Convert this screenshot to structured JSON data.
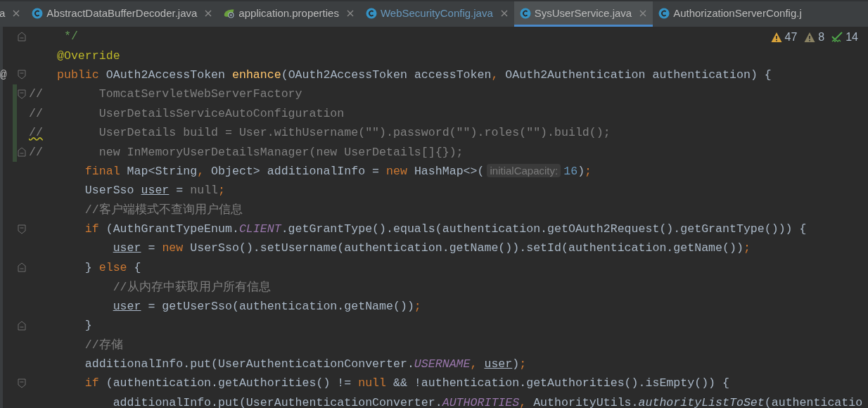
{
  "tabs": [
    {
      "label": "a",
      "kind": "plain",
      "selected": false,
      "closable": true
    },
    {
      "label": "AbstractDataBufferDecoder.java",
      "kind": "class",
      "selected": false,
      "closable": true
    },
    {
      "label": "application.properties",
      "kind": "spring",
      "selected": false,
      "closable": true
    },
    {
      "label": "WebSecurityConfig.java",
      "kind": "class",
      "selected": false,
      "closable": true
    },
    {
      "label": "SysUserService.java",
      "kind": "class",
      "selected": true,
      "closable": true
    },
    {
      "label": "AuthorizationServerConfig.j",
      "kind": "class",
      "selected": false,
      "closable": false
    }
  ],
  "inspections": [
    {
      "kind": "warning",
      "count": "47"
    },
    {
      "kind": "weak-warning",
      "count": "8"
    },
    {
      "kind": "typo",
      "count": "14"
    }
  ],
  "lines": [
    {
      "fold_end": true,
      "tokens": [
        {
          "kind": "doc",
          "text": " */"
        }
      ]
    },
    {
      "tokens": [
        {
          "kind": "ann",
          "text": "@Override"
        }
      ]
    },
    {
      "at_mark": "@",
      "fold_start": true,
      "tokens": [
        {
          "kind": "kw",
          "text": "public "
        },
        {
          "kind": "p",
          "text": "OAuth2AccessToken "
        },
        {
          "kind": "decl",
          "text": "enhance"
        },
        {
          "kind": "p",
          "text": "(OAuth2AccessToken accessToken"
        },
        {
          "kind": "kw",
          "text": ", "
        },
        {
          "kind": "p",
          "text": "OAuth2Authentication authentication) {"
        }
      ],
      "children": [
        {
          "changed": true,
          "fold_start": true,
          "prefix": "//",
          "tokens": [
            {
              "kind": "cm",
              "text": "  TomcatServletWebServerFactory"
            }
          ]
        },
        {
          "changed": true,
          "prefix": "//",
          "tokens": [
            {
              "kind": "cm",
              "text": "  UserDetailsServiceAutoConfiguration"
            }
          ]
        },
        {
          "changed": true,
          "prefix": "//",
          "squiggle": true,
          "tokens": [
            {
              "kind": "cm",
              "text": "  UserDetails build = User.withUsername(\"\").password(\"\").roles(\"\").build();"
            }
          ]
        },
        {
          "changed": true,
          "fold_end": true,
          "prefix": "//",
          "tokens": [
            {
              "kind": "cm",
              "text": "  new InMemoryUserDetailsManager(new UserDetails[]{});"
            }
          ]
        },
        {
          "tokens": [
            {
              "kind": "kw",
              "text": "final "
            },
            {
              "kind": "p",
              "text": "Map<String"
            },
            {
              "kind": "kw",
              "text": ", "
            },
            {
              "kind": "p",
              "text": "Object> additionalInfo = "
            },
            {
              "kind": "kw",
              "text": "new "
            },
            {
              "kind": "p",
              "text": "HashMap<>("
            },
            {
              "kind": "hint",
              "text": "initialCapacity:"
            },
            {
              "kind": "num",
              "text": "16"
            },
            {
              "kind": "p",
              "text": ")"
            },
            {
              "kind": "kw",
              "text": ";"
            }
          ]
        },
        {
          "tokens": [
            {
              "kind": "p",
              "text": "UserSso "
            },
            {
              "kind": "var",
              "text": "user"
            },
            {
              "kind": "p",
              "text": " = "
            },
            {
              "kind": "dim",
              "text": "null"
            },
            {
              "kind": "kw",
              "text": ";"
            }
          ]
        },
        {
          "tokens": [
            {
              "kind": "cm",
              "text": "//客户端模式不查询用户信息"
            }
          ]
        },
        {
          "fold_start": true,
          "tokens": [
            {
              "kind": "kw",
              "text": "if "
            },
            {
              "kind": "p",
              "text": "(AuthGrantTypeEnum."
            },
            {
              "kind": "const",
              "text": "CLIENT"
            },
            {
              "kind": "p",
              "text": ".getGrantType().equals(authentication.getOAuth2Request().getGrantType())) {"
            }
          ],
          "children": [
            {
              "tokens": [
                {
                  "kind": "var",
                  "text": "user"
                },
                {
                  "kind": "p",
                  "text": " = "
                },
                {
                  "kind": "kw",
                  "text": "new "
                },
                {
                  "kind": "p",
                  "text": "UserSso().setUsername(authentication.getName()).setId(authentication.getName())"
                },
                {
                  "kind": "kw",
                  "text": ";"
                }
              ]
            }
          ]
        },
        {
          "fold_end": true,
          "tokens": [
            {
              "kind": "p",
              "text": "} "
            },
            {
              "kind": "kw",
              "text": "else "
            },
            {
              "kind": "p",
              "text": "{"
            }
          ],
          "children": [
            {
              "tokens": [
                {
                  "kind": "cm",
                  "text": "//从内存中获取用户所有信息"
                }
              ]
            },
            {
              "tokens": [
                {
                  "kind": "var",
                  "text": "user"
                },
                {
                  "kind": "p",
                  "text": " = getUserSso(authentication.getName())"
                },
                {
                  "kind": "kw",
                  "text": ";"
                }
              ]
            }
          ]
        },
        {
          "fold_end": true,
          "tokens": [
            {
              "kind": "p",
              "text": "}"
            }
          ]
        },
        {
          "tokens": [
            {
              "kind": "cm",
              "text": "//存储"
            }
          ]
        },
        {
          "tokens": [
            {
              "kind": "p",
              "text": "additionalInfo.put(UserAuthenticationConverter."
            },
            {
              "kind": "const",
              "text": "USERNAME"
            },
            {
              "kind": "kw",
              "text": ", "
            },
            {
              "kind": "var",
              "text": "user"
            },
            {
              "kind": "p",
              "text": ")"
            },
            {
              "kind": "kw",
              "text": ";"
            }
          ]
        },
        {
          "fold_start": true,
          "tokens": [
            {
              "kind": "kw",
              "text": "if "
            },
            {
              "kind": "p",
              "text": "(authentication.getAuthorities() != "
            },
            {
              "kind": "kw",
              "text": "null "
            },
            {
              "kind": "p",
              "text": "&& !authentication.getAuthorities().isEmpty()) {"
            }
          ],
          "children": [
            {
              "tokens": [
                {
                  "kind": "p",
                  "text": "additionalInfo.put(UserAuthenticationConverter."
                },
                {
                  "kind": "const",
                  "text": "AUTHORITIES"
                },
                {
                  "kind": "kw",
                  "text": ", "
                },
                {
                  "kind": "p",
                  "text": "AuthorityUtils."
                },
                {
                  "kind": "it",
                  "text": "authorityListToSet"
                },
                {
                  "kind": "p",
                  "text": "(authenticatio"
                }
              ]
            }
          ]
        }
      ]
    }
  ]
}
